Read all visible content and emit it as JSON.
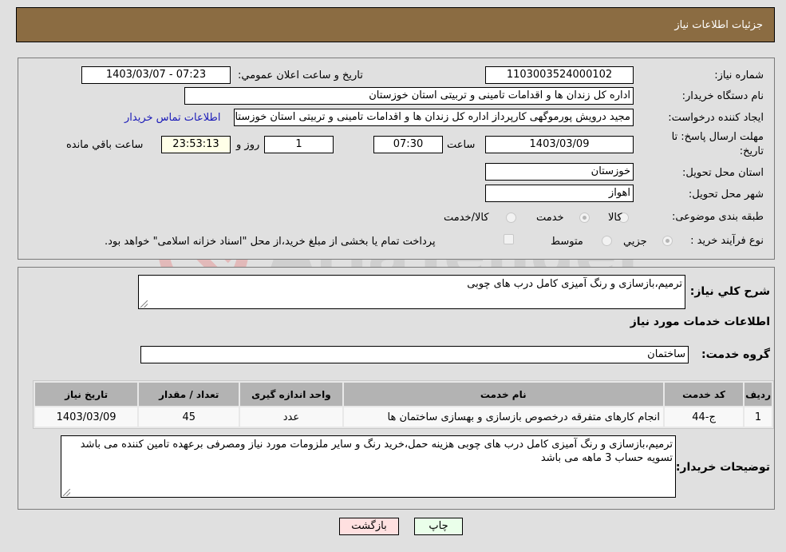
{
  "header": {
    "title": "جزئیات اطلاعات نیاز"
  },
  "need_info": {
    "need_number_label": "شماره نیاز:",
    "need_number": "1103003524000102",
    "announce_label": "تاریخ و ساعت اعلان عمومي:",
    "announce_value": "1403/03/07 - 07:23",
    "buyer_org_label": "نام دستگاه خریدار:",
    "buyer_org": "اداره کل زندان ها و اقدامات تامینی و تربیتی استان خوزستان",
    "creator_label": "ایجاد کننده درخواست:",
    "creator": "مجید درویش پورموگهی کارپرداز اداره کل زندان ها و اقدامات تامینی و تربیتی استان خوزستان",
    "contact_link": "اطلاعات تماس خریدار",
    "deadline_label_line1": "مهلت ارسال پاسخ: تا",
    "deadline_label_line2": "تاریخ:",
    "deadline_date": "1403/03/09",
    "time_label": "ساعت",
    "deadline_time": "07:30",
    "days_value": "1",
    "days_label": "روز و",
    "remaining_time": "23:53:13",
    "remaining_label": "ساعت باقي مانده",
    "province_label": "استان محل تحویل:",
    "province": "خوزستان",
    "city_label": "شهر محل تحویل:",
    "city": "اهواز",
    "category_label": "طبقه بندی موضوعی:",
    "category_options": [
      {
        "label": "کالا",
        "checked": false
      },
      {
        "label": "خدمت",
        "checked": true
      },
      {
        "label": "کالا/خدمت",
        "checked": false
      }
    ],
    "process_label": "نوع فرآیند خرید :",
    "process_options": [
      {
        "label": "جزيي",
        "checked": true
      },
      {
        "label": "متوسط",
        "checked": false
      }
    ],
    "treasury_checkbox_label": "پرداخت تمام یا بخشی از مبلغ خرید،از محل \"اسناد خزانه اسلامی\" خواهد بود.",
    "treasury_checked": false
  },
  "details": {
    "summary_label": "شرح کلي نیاز:",
    "summary": "ترمیم،بازسازی و رنگ آمیزی کامل درب های چوبی",
    "services_heading": "اطلاعات خدمات مورد نیاز",
    "service_group_label": "گروه خدمت:",
    "service_group": "ساختمان",
    "table": {
      "headers": [
        "ردیف",
        "کد خدمت",
        "نام خدمت",
        "واحد اندازه گیری",
        "تعداد / مقدار",
        "تاریخ نیاز"
      ],
      "rows": [
        [
          "1",
          "ج-44",
          "انجام کارهای متفرقه درخصوص بازسازی و بهسازی ساختمان ها",
          "عدد",
          "45",
          "1403/03/09"
        ]
      ]
    },
    "buyer_notes_label": "توضیحات خریدار:",
    "buyer_notes": "ترمیم،بازسازی و رنگ آمیزی کامل درب های چوبی هزینه حمل،خرید رنگ و سایر ملزومات مورد نیاز ومصرفی برعهده تامین کننده می باشد تسویه حساب 3 ماهه می باشد"
  },
  "buttons": {
    "print": "چاپ",
    "back": "بازگشت"
  },
  "watermark": {
    "text": "AriaTender.neT",
    "color": "#d9a8a8"
  }
}
